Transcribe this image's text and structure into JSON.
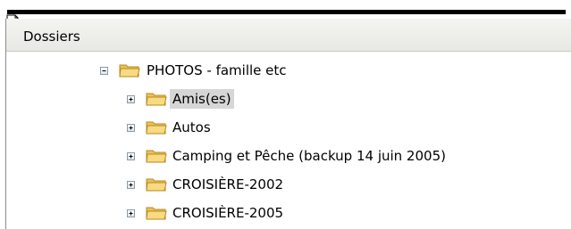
{
  "header": {
    "title": "Dossiers"
  },
  "tree": {
    "root": {
      "label": "PHOTOS - famille etc",
      "expander": "minus"
    },
    "children": [
      {
        "label": "Amis(es)",
        "expander": "plus",
        "selected": true
      },
      {
        "label": "Autos",
        "expander": "plus",
        "selected": false
      },
      {
        "label": "Camping et Pêche (backup 14 juin 2005)",
        "expander": "plus",
        "selected": false
      },
      {
        "label": "CROISIÈRE-2002",
        "expander": "plus",
        "selected": false
      },
      {
        "label": "CROISIÈRE-2005",
        "expander": "plus",
        "selected": false
      }
    ]
  },
  "colors": {
    "folder_body": "#f6d77a",
    "folder_edge": "#c99a2e",
    "selection": "#d6d6d6",
    "header_bg": "#ececea"
  },
  "icons": {
    "header": "folder-pane-icon",
    "expand": "plus-box-icon",
    "collapse": "minus-box-icon",
    "folder": "folder-icon"
  }
}
